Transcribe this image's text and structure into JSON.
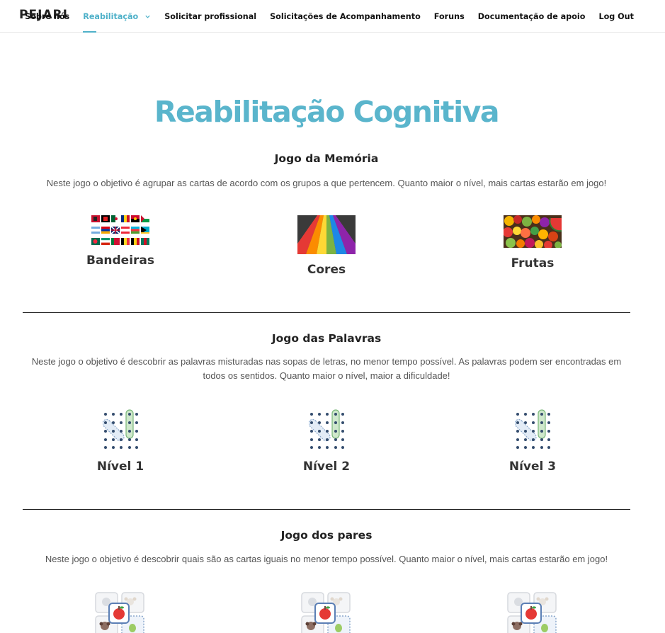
{
  "header": {
    "logo": "PEJARI",
    "nav": [
      {
        "label": "Sobre nós"
      },
      {
        "label": "Reabilitação"
      },
      {
        "label": "Solicitar profissional"
      },
      {
        "label": "Solicitações de Acompanhamento"
      },
      {
        "label": "Foruns"
      },
      {
        "label": "Documentação de apoio"
      },
      {
        "label": "Log Out"
      }
    ]
  },
  "page": {
    "title": "Reabilitação Cognitiva"
  },
  "memory": {
    "title": "Jogo da Memória",
    "desc": "Neste jogo o objetivo é agrupar as cartas de acordo com os grupos a que pertencem. Quanto maior o nível, mais cartas estarão em jogo!",
    "cards": [
      {
        "label": "Bandeiras"
      },
      {
        "label": "Cores"
      },
      {
        "label": "Frutas"
      }
    ]
  },
  "words": {
    "title": "Jogo das Palavras",
    "desc": "Neste jogo o objetivo é descobrir as palavras misturadas nas sopas de letras, no menor tempo possível. As palavras podem ser encontradas em todos os sentidos. Quanto maior o nível, maior a dificuldade!",
    "cards": [
      {
        "label": "Nível 1"
      },
      {
        "label": "Nível 2"
      },
      {
        "label": "Nível 3"
      }
    ]
  },
  "pairs": {
    "title": "Jogo dos pares",
    "desc": "Neste jogo o objetivo é descobrir quais são as cartas iguais no menor tempo possível. Quanto maior o nível, mais cartas estarão em jogo!"
  },
  "colors": {
    "accent": "#5ab5cc",
    "text": "#333333"
  }
}
